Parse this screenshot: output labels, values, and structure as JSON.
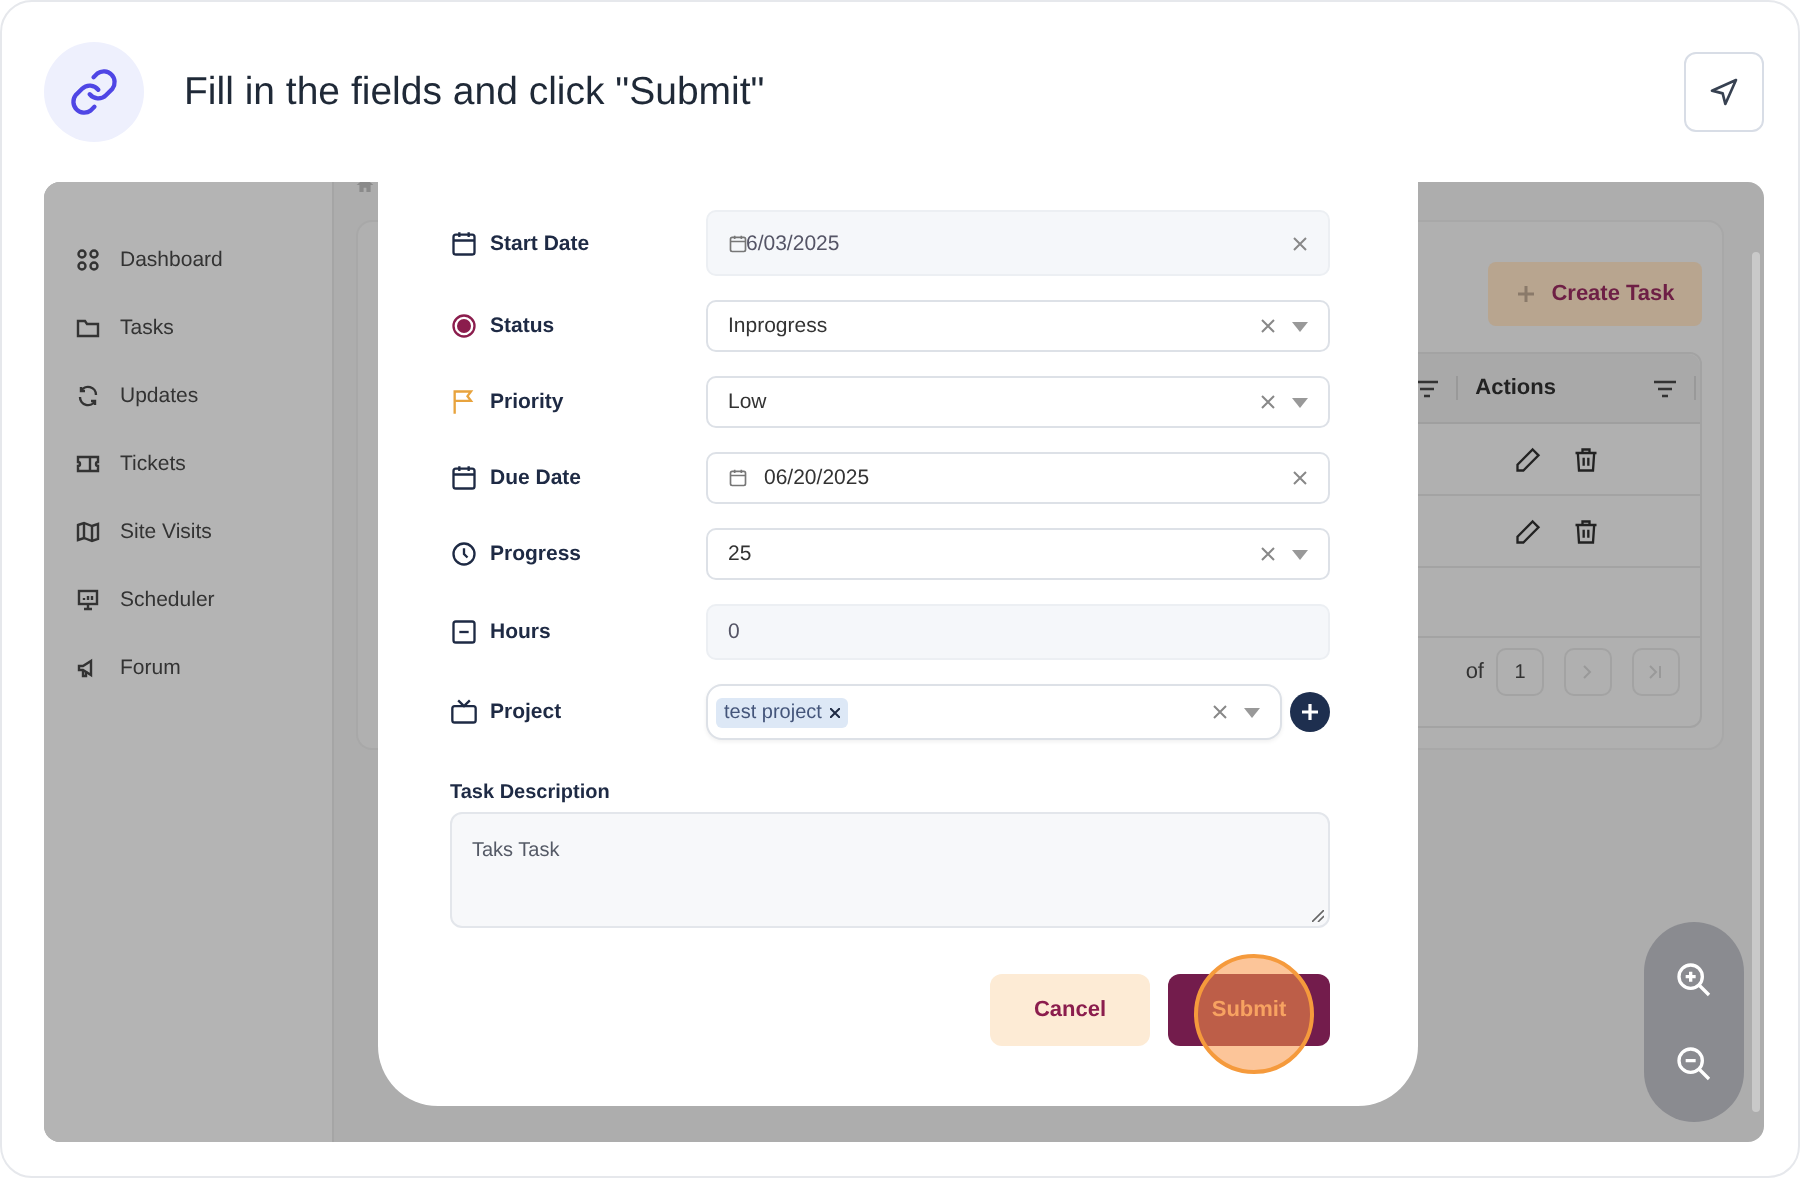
{
  "header": {
    "title": "Fill in the fields and click \"Submit\""
  },
  "sidebar": {
    "items": [
      {
        "label": "Dashboard"
      },
      {
        "label": "Tasks"
      },
      {
        "label": "Updates"
      },
      {
        "label": "Tickets"
      },
      {
        "label": "Site Visits"
      },
      {
        "label": "Scheduler"
      },
      {
        "label": "Forum"
      }
    ]
  },
  "page": {
    "create_button": "Create Task",
    "table": {
      "columns": [
        "Actions"
      ],
      "rows": [
        {
          "kind": "actions"
        },
        {
          "kind": "actions"
        }
      ]
    },
    "pagination": {
      "of": "of",
      "total": "1"
    }
  },
  "form": {
    "fields": [
      {
        "label": "Start Date",
        "kind": "date",
        "value": "6/03/2025",
        "disabled": true
      },
      {
        "label": "Status",
        "kind": "select",
        "value": "Inprogress",
        "disabled": false
      },
      {
        "label": "Priority",
        "kind": "select",
        "value": "Low",
        "disabled": false
      },
      {
        "label": "Due Date",
        "kind": "date",
        "value": "06/20/2025",
        "disabled": false
      },
      {
        "label": "Progress",
        "kind": "select",
        "value": "25",
        "disabled": false
      },
      {
        "label": "Hours",
        "kind": "input",
        "value": "0",
        "disabled": true
      },
      {
        "label": "Project",
        "kind": "tags",
        "tags": [
          "test project"
        ],
        "disabled": false
      }
    ],
    "description": {
      "label": "Task Description",
      "value": "Taks Task"
    },
    "buttons": [
      {
        "label": "Cancel",
        "kind": "secondary"
      },
      {
        "label": "Submit",
        "kind": "primary"
      }
    ]
  }
}
